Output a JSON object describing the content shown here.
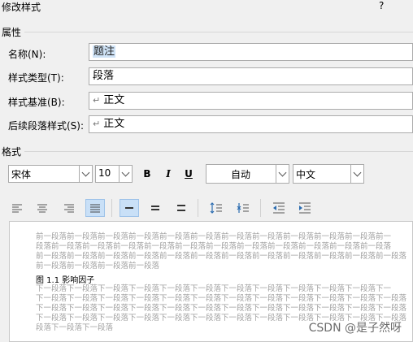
{
  "dialog": {
    "title": "修改样式",
    "help": "?"
  },
  "properties": {
    "section": "属性",
    "name_label": "名称(N):",
    "name_value": "题注",
    "type_label": "样式类型(T):",
    "type_value": "段落",
    "based_on_label": "样式基准(B):",
    "based_on_value": "正文",
    "next_label": "后续段落样式(S):",
    "next_value": "正文",
    "para_mark": "↵"
  },
  "format": {
    "section": "格式",
    "font": "宋体",
    "size": "10",
    "bold": "B",
    "italic": "I",
    "underline": "U",
    "color": "自动",
    "language": "中文"
  },
  "preview": {
    "prev_lines": [
      "前一段落前一段落前一段落前一段落前一段落前一段落前一段落前一段落前一段落前一段落前一段落前一",
      "段落前一段落前一段落前一段落前一段落前一段落前一段落前一段落前一段落前一段落前一段落前一段落",
      "前一段落前一段落前一段落前一段落前一段落前一段落前一段落前一段落前一段落前一段落前一段落前一段落",
      "前一段落前一段落前一段落前一段落"
    ],
    "caption": "图 1.1 影响因子",
    "next_lines": [
      "下一段落下一段落下一段落下一段落下一段落下一段落下一段落下一段落下一段落下一段落下一段落下一",
      "下一段落下一段落下一段落下一段落下一段落下一段落下一段落下一段落下一段落下一段落下一段落下一段落",
      "下一段落下一段落下一段落下一段落下一段落下一段落下一段落下一段落下一段落下一段落下一段落下一段落",
      "下一段落下一段落下一段落下一段落下一段落下一段落下一段落下一段落下一段落下一段落下一段落下一段落",
      "段落下一段落下一段落"
    ]
  },
  "watermark": "CSDN @是子然呀"
}
